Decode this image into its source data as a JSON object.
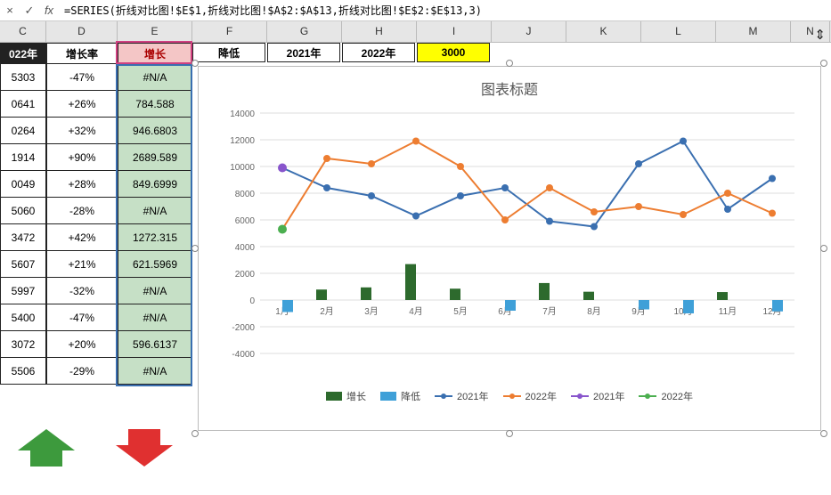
{
  "formula_bar": {
    "cancel": "×",
    "confirm": "✓",
    "fx": "fx",
    "formula": "=SERIES(折线对比图!$E$1,折线对比图!$A$2:$A$13,折线对比图!$E$2:$E$13,3)"
  },
  "columns": [
    "C",
    "D",
    "E",
    "F",
    "G",
    "H",
    "I",
    "J",
    "K",
    "L",
    "M",
    "N"
  ],
  "headers": {
    "C": "022年",
    "D": "增长率",
    "E": "增长",
    "F": "降低",
    "G": "2021年",
    "H": "2022年",
    "I": "3000"
  },
  "col_C": [
    "5303",
    "0641",
    "0264",
    "1914",
    "0049",
    "5060",
    "3472",
    "5607",
    "5997",
    "5400",
    "3072",
    "5506"
  ],
  "col_D": [
    "-47%",
    "+26%",
    "+32%",
    "+90%",
    "+28%",
    "-28%",
    "+42%",
    "+21%",
    "-32%",
    "-47%",
    "+20%",
    "-29%"
  ],
  "col_E": [
    "#N/A",
    "784.588",
    "946.6803",
    "2689.589",
    "849.6999",
    "#N/A",
    "1272.315",
    "621.5969",
    "#N/A",
    "#N/A",
    "596.6137",
    "#N/A"
  ],
  "chart": {
    "title": "图表标题",
    "legend": {
      "grow": "增长",
      "reduce": "降低",
      "y2021": "2021年",
      "y2022": "2022年",
      "y2021p": "2021年",
      "y2022p": "2022年"
    },
    "colors": {
      "grow": "#2d6a2d",
      "reduce": "#3fa0d8",
      "y2021": "#3a6fb0",
      "y2022": "#ed7d31",
      "y2021p": "#8855cc",
      "y2022p": "#4caf50"
    }
  },
  "chart_data": {
    "type": "combo",
    "title": "图表标题",
    "categories": [
      "1月",
      "2月",
      "3月",
      "4月",
      "5月",
      "6月",
      "7月",
      "8月",
      "9月",
      "10月",
      "11月",
      "12月"
    ],
    "ylim": [
      -4000,
      14000
    ],
    "ytick": 2000,
    "series": [
      {
        "name": "增长",
        "type": "bar",
        "color": "#2d6a2d",
        "values": [
          null,
          785,
          947,
          2690,
          850,
          null,
          1272,
          622,
          null,
          null,
          597,
          null
        ]
      },
      {
        "name": "降低",
        "type": "bar",
        "color": "#3fa0d8",
        "values": [
          -900,
          null,
          null,
          null,
          null,
          -800,
          null,
          null,
          -700,
          -1000,
          null,
          -850
        ]
      },
      {
        "name": "2021年",
        "type": "line",
        "color": "#3a6fb0",
        "values": [
          9900,
          8400,
          7800,
          6300,
          7800,
          8400,
          5900,
          5500,
          10200,
          11900,
          6800,
          9100
        ]
      },
      {
        "name": "2022年",
        "type": "line",
        "color": "#ed7d31",
        "values": [
          5300,
          10600,
          10200,
          11900,
          10000,
          6000,
          8400,
          6600,
          7000,
          6400,
          8000,
          6500
        ]
      },
      {
        "name": "2021年",
        "type": "point",
        "color": "#8855cc",
        "values": [
          9900,
          null,
          null,
          null,
          null,
          null,
          null,
          null,
          null,
          null,
          null,
          null
        ]
      },
      {
        "name": "2022年",
        "type": "point",
        "color": "#4caf50",
        "values": [
          5300,
          null,
          null,
          null,
          null,
          null,
          null,
          null,
          null,
          null,
          null,
          null
        ]
      }
    ]
  }
}
